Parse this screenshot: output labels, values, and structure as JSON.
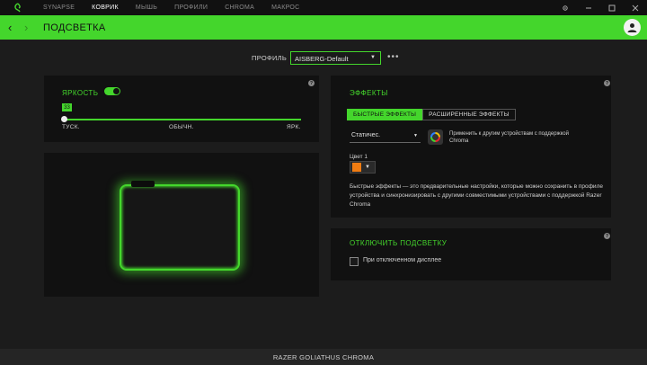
{
  "nav": {
    "items": [
      {
        "label": "SYNAPSE",
        "active": false
      },
      {
        "label": "КОВРИК",
        "active": true
      },
      {
        "label": "МЫШЬ",
        "active": false
      },
      {
        "label": "ПРОФИЛИ",
        "active": false
      },
      {
        "label": "CHROMA",
        "active": false
      },
      {
        "label": "МАКРОС",
        "active": false
      }
    ],
    "logo_icon": "razer-snake-icon",
    "window_icons": [
      "settings-icon",
      "minimize-icon",
      "maximize-icon",
      "close-icon"
    ]
  },
  "header": {
    "title": "ПОДСВЕТКА",
    "back_icon": "chevron-left-icon",
    "forward_icon": "chevron-right-icon",
    "accent_color": "#44d62c"
  },
  "profile": {
    "label": "ПРОФИЛЬ",
    "value": "AISBERG-Default",
    "more_icon": "more-dots-icon"
  },
  "brightness": {
    "title": "ЯРКОСТЬ",
    "enabled": true,
    "value": "33",
    "level_percent": 0,
    "labels": {
      "min": "ТУСК.",
      "mid": "ОБЫЧН.",
      "max": "ЯРК."
    }
  },
  "effects": {
    "title": "ЭФФЕКТЫ",
    "tabs": [
      {
        "label": "БЫСТРЫЕ ЭФФЕКТЫ",
        "active": true
      },
      {
        "label": "РАСШИРЕННЫЕ ЭФФЕКТЫ",
        "active": false
      }
    ],
    "selected_effect": "Статичес.",
    "apply_chroma_text": "Применить к другим устройствам с поддержкой Chroma",
    "color_label": "Цвет 1",
    "color_value": "#f07c12",
    "description": "Быстрые эффекты — это предварительные настройки, которые можно сохранить в профиле устройства и синхронизировать с другими совместимыми устройствами с поддержкой Razer Chroma"
  },
  "disable": {
    "title": "ОТКЛЮЧИТЬ ПОДСВЕТКУ",
    "option_label": "При отключенном дисплее",
    "checked": false
  },
  "footer": {
    "device_name": "RAZER GOLIATHUS CHROMA"
  }
}
